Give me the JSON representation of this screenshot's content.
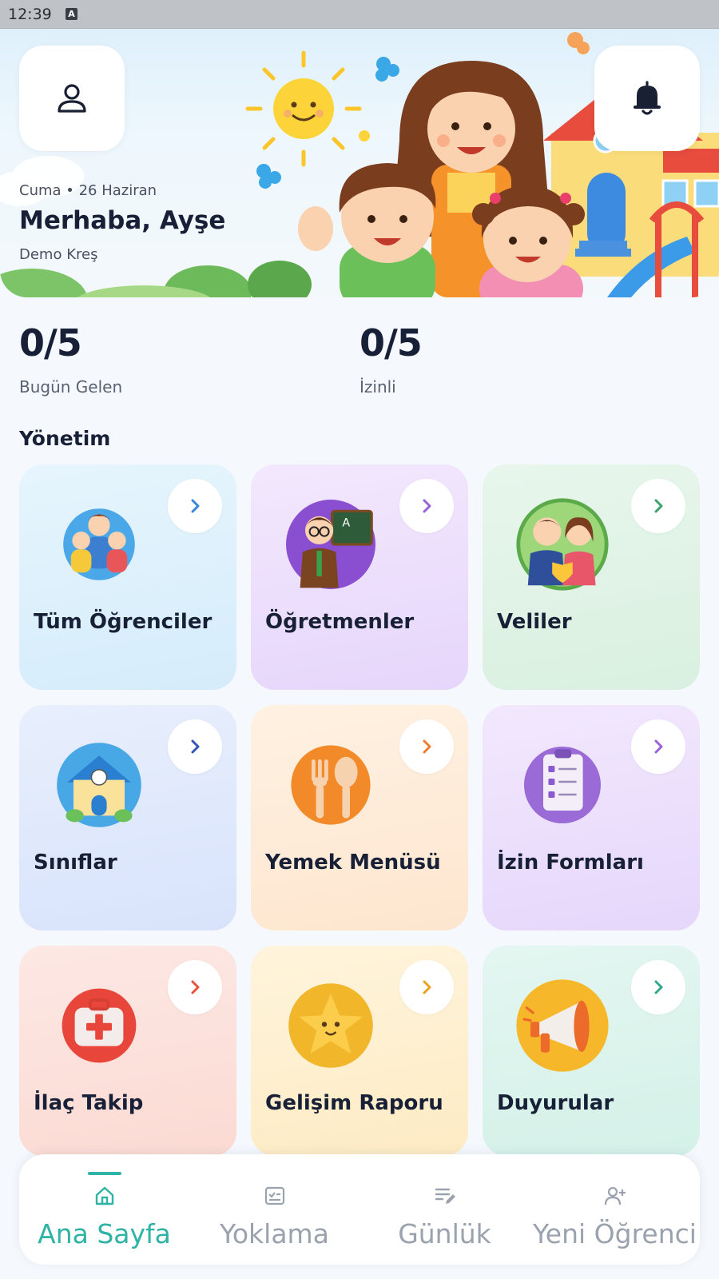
{
  "status_bar": {
    "time": "12:39",
    "indicator": "A"
  },
  "header": {
    "date": "Cuma • 26 Haziran",
    "greeting": "Merhaba, Ayşe",
    "school": "Demo Kreş",
    "profile_icon": "person-icon",
    "notification_icon": "bell-icon"
  },
  "stats": [
    {
      "value": "0/5",
      "label": "Bugün Gelen"
    },
    {
      "value": "0/5",
      "label": "İzinli"
    }
  ],
  "section_title": "Yönetim",
  "cards": [
    {
      "label": "Tüm Öğrenciler",
      "icon": "children-group-icon",
      "bg_top": "#e6f5fd",
      "bg_bottom": "#d5ecfb",
      "arrow_color": "#3a86d8"
    },
    {
      "label": "Öğretmenler",
      "icon": "teacher-icon",
      "bg_top": "#f3e8fd",
      "bg_bottom": "#e6d6fb",
      "arrow_color": "#9a62d8"
    },
    {
      "label": "Veliler",
      "icon": "parents-icon",
      "bg_top": "#e8f6ec",
      "bg_bottom": "#d9f0e0",
      "arrow_color": "#3ba46a"
    },
    {
      "label": "Sınıflar",
      "icon": "school-house-icon",
      "bg_top": "#e8effd",
      "bg_bottom": "#d8e3fb",
      "arrow_color": "#3555b8"
    },
    {
      "label": "Yemek Menüsü",
      "icon": "fork-spoon-icon",
      "bg_top": "#fff1e2",
      "bg_bottom": "#fde6cf",
      "arrow_color": "#ee7c2e"
    },
    {
      "label": "İzin Formları",
      "icon": "clipboard-checklist-icon",
      "bg_top": "#f2e8fd",
      "bg_bottom": "#e5d7fb",
      "arrow_color": "#9a62d8"
    },
    {
      "label": "İlaç Takip",
      "icon": "first-aid-kit-icon",
      "bg_top": "#fde8e4",
      "bg_bottom": "#fbdad3",
      "arrow_color": "#e8533e"
    },
    {
      "label": "Gelişim Raporu",
      "icon": "star-icon",
      "bg_top": "#fff4dc",
      "bg_bottom": "#fdebc4",
      "arrow_color": "#eca21e"
    },
    {
      "label": "Duyurular",
      "icon": "megaphone-icon",
      "bg_top": "#e4f6f1",
      "bg_bottom": "#d4f1e8",
      "arrow_color": "#2fa88e"
    }
  ],
  "bottom_nav": [
    {
      "label": "Ana Sayfa",
      "icon": "home-icon",
      "active": true
    },
    {
      "label": "Yoklama",
      "icon": "attendance-check-icon",
      "active": false
    },
    {
      "label": "Günlük",
      "icon": "journal-edit-icon",
      "active": false
    },
    {
      "label": "Yeni Öğrenci",
      "icon": "add-person-icon",
      "active": false
    }
  ],
  "colors": {
    "accent": "#2fb3a4",
    "text_dark": "#172036",
    "text_muted": "#5a6272",
    "nav_inactive": "#9aa2ae"
  }
}
